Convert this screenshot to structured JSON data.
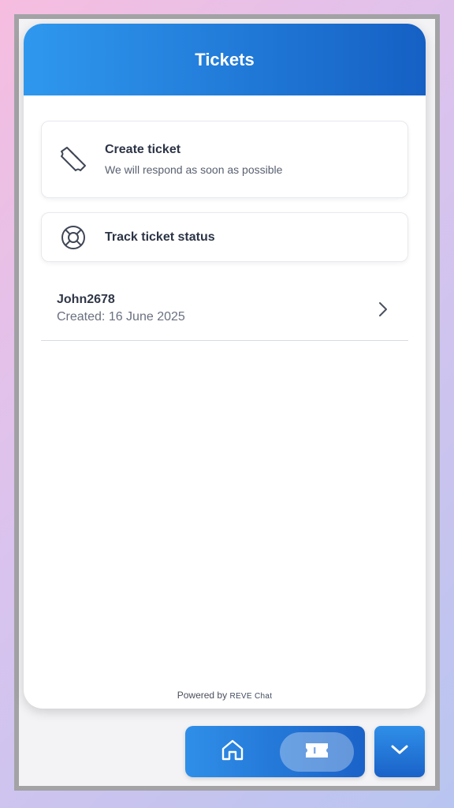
{
  "header": {
    "title": "Tickets"
  },
  "actions": {
    "create": {
      "title": "Create ticket",
      "subtitle": "We will respond as soon as possible",
      "icon": "ticket-icon"
    },
    "track": {
      "title": "Track ticket status",
      "icon": "lifebuoy-icon"
    }
  },
  "tickets": [
    {
      "name": "John2678",
      "created": "Created: 16 June 2025"
    }
  ],
  "footer": {
    "powered_by": "Powered by",
    "brand": "REVE Chat"
  },
  "nav": {
    "home_icon": "home-icon",
    "tickets_icon": "ticket-icon",
    "active": "tickets",
    "collapse_icon": "chevron-down-icon"
  },
  "colors": {
    "primary": "#1c6fd6",
    "header_start": "#2f98ee",
    "header_end": "#1560c4"
  }
}
